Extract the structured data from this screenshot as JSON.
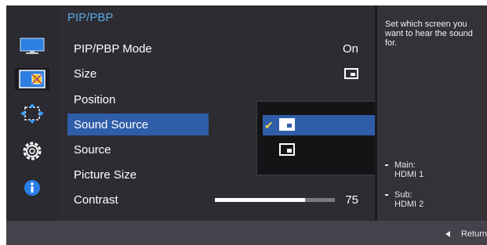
{
  "menu": {
    "title": "PIP/PBP",
    "rows": [
      {
        "label": "PIP/PBP Mode",
        "value": "On"
      },
      {
        "label": "Size",
        "value_icon": "pip-size-icon"
      },
      {
        "label": "Position"
      },
      {
        "label": "Sound Source"
      },
      {
        "label": "Source"
      },
      {
        "label": "Picture Size"
      },
      {
        "label": "Contrast",
        "value": "75"
      }
    ],
    "selected_row": "Sound Source"
  },
  "contrast": {
    "value": 75,
    "max": 100
  },
  "sidebar": {
    "icons": [
      "picture-icon",
      "pip-pbp-icon",
      "resize-icon",
      "gear-icon",
      "info-icon"
    ],
    "active": "pip-pbp-icon"
  },
  "sound_source_popup": {
    "options": [
      "main-screen-sound-icon",
      "sub-screen-sound-icon"
    ],
    "selected_index": 0
  },
  "help": {
    "text": "Set which screen you want to hear the sound for.",
    "main_label": "Main:",
    "main_value": "HDMI 1",
    "sub_label": "Sub:",
    "sub_value": "HDMI 2"
  },
  "footer": {
    "return_label": "Return"
  },
  "colors": {
    "accent": "#2f5da8",
    "title": "#59a8e6",
    "check": "#f6d84a"
  }
}
